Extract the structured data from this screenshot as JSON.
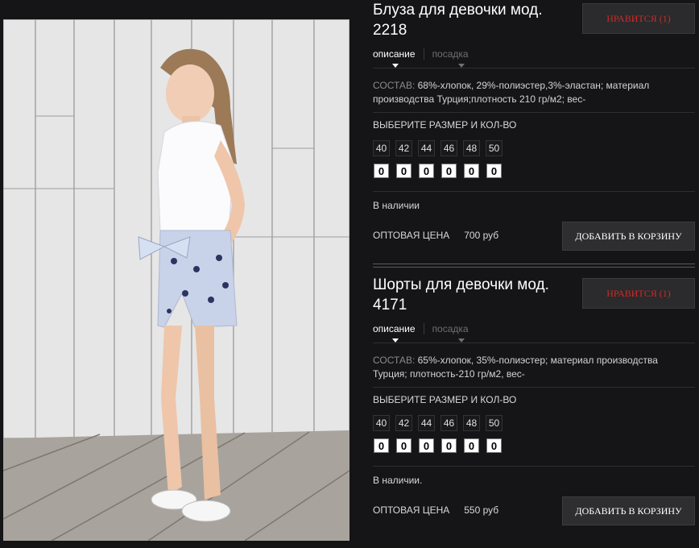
{
  "products": [
    {
      "title": "Блуза для девочки мод. 2218",
      "like_label": "НРАВИТСЯ (1)",
      "tabs": [
        "описание",
        "посадка"
      ],
      "composition_label": "СОСТАВ:",
      "composition_text": "68%-хлопок, 29%-полиэстер,3%-эластан; материал производства Турция;плотность 210 гр/м2; вес-",
      "size_heading": "ВЫБЕРИТЕ РАЗМЕР И КОЛ-ВО",
      "sizes": [
        "40",
        "42",
        "44",
        "46",
        "48",
        "50"
      ],
      "quantities": [
        "0",
        "0",
        "0",
        "0",
        "0",
        "0"
      ],
      "stock": "В наличии",
      "price_label": "ОПТОВАЯ ЦЕНА",
      "price": "700 руб",
      "cart_label": "ДОБАВИТЬ В КОРЗИНУ"
    },
    {
      "title": "Шорты для девочки мод. 4171",
      "like_label": "НРАВИТСЯ (1)",
      "tabs": [
        "описание",
        "посадка"
      ],
      "composition_label": "СОСТАВ:",
      "composition_text": "65%-хлопок, 35%-полиэстер; материал производства Турция; плотность-210 гр/м2, вес-",
      "size_heading": "ВЫБЕРИТЕ РАЗМЕР И КОЛ-ВО",
      "sizes": [
        "40",
        "42",
        "44",
        "46",
        "48",
        "50"
      ],
      "quantities": [
        "0",
        "0",
        "0",
        "0",
        "0",
        "0"
      ],
      "stock": "В наличии.",
      "price_label": "ОПТОВАЯ ЦЕНА",
      "price": "550 руб",
      "cart_label": "ДОБАВИТЬ В КОРЗИНУ"
    }
  ],
  "colors": {
    "background": "#151417",
    "like_text": "#cc2a2a",
    "button_bg": "#2e2d2f"
  }
}
